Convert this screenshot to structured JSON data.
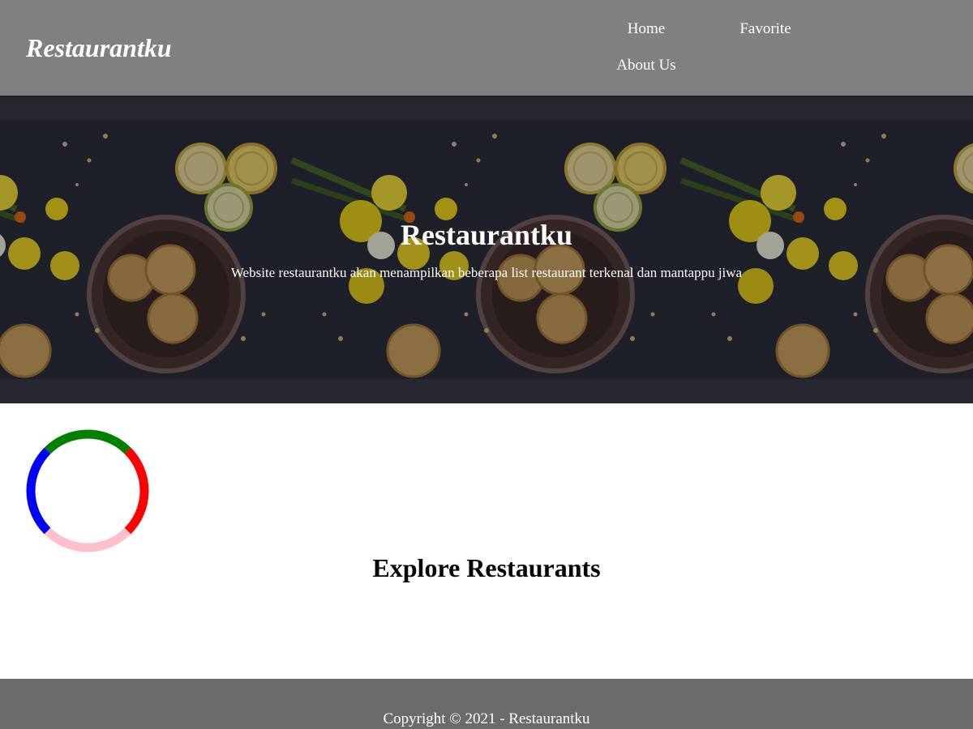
{
  "header": {
    "brand": "Restaurantku",
    "nav": {
      "home": "Home",
      "favorite": "Favorite",
      "about": "About Us"
    }
  },
  "hero": {
    "title": "Restaurantku",
    "tagline": "Website restaurantku akan menampilkan beberapa list restaurant terkenal dan mantappu jiwa",
    "image": "food-flatlay-image"
  },
  "loader": {
    "icon": "loading-spinner-icon",
    "colors": [
      "#008000",
      "#ff0000",
      "#ffc0cb",
      "#0000ff"
    ]
  },
  "main": {
    "section_title": "Explore Restaurants"
  },
  "footer": {
    "copyright": "Copyright © 2021 - Restaurantku"
  },
  "colors": {
    "header_bg": "#808080",
    "footer_bg": "#6b6b6b",
    "text_light": "#ffffff",
    "text_dark": "#000000"
  }
}
